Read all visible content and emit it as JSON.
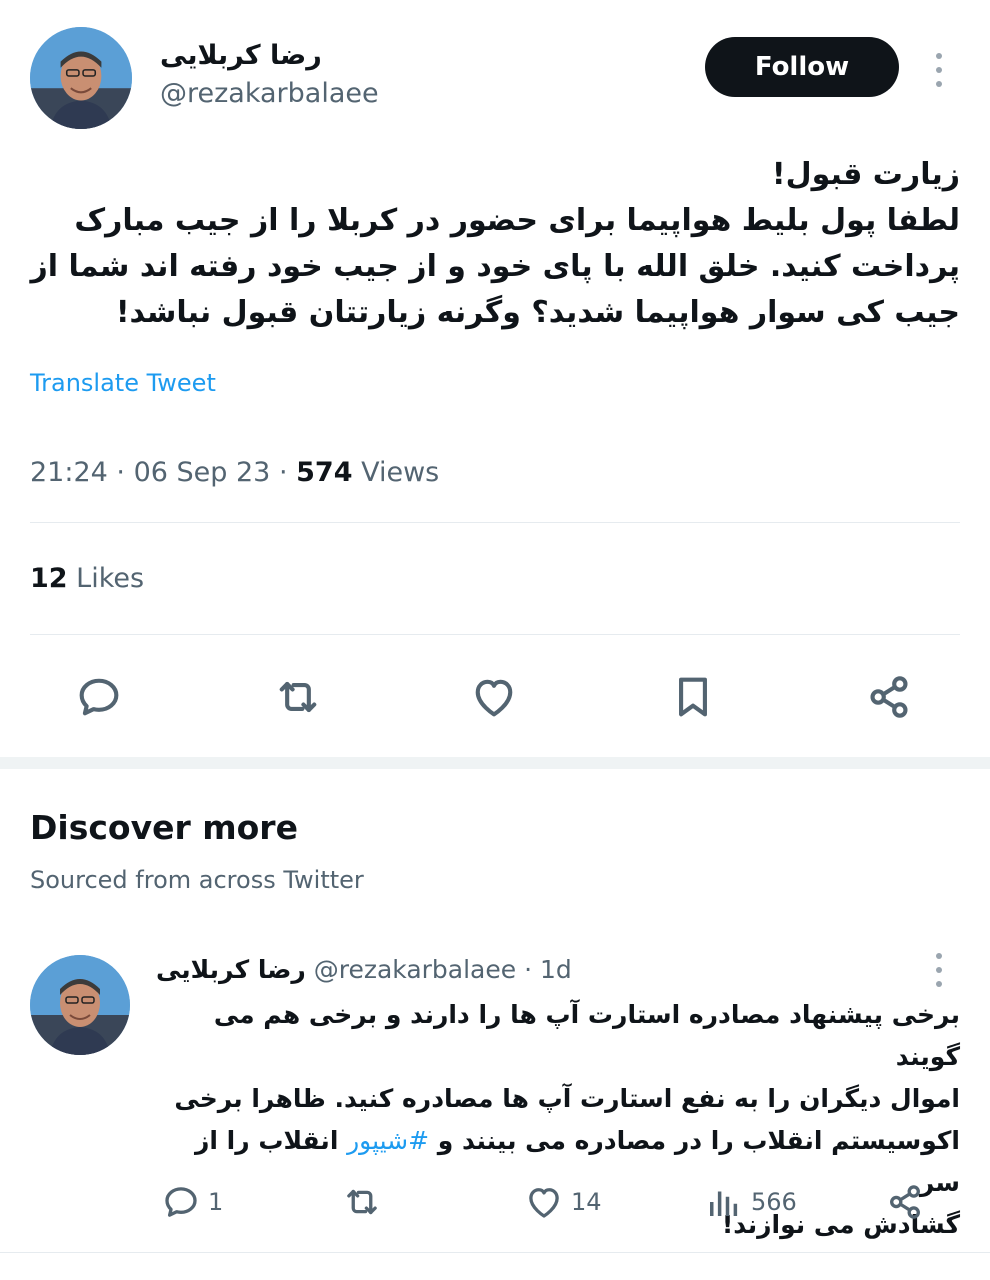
{
  "tweet": {
    "author_name": "رضا کربلایی",
    "author_handle": "@rezakarbalaee",
    "follow_label": "Follow",
    "text_lines": [
      "زیارت قبول!",
      "لطفا پول بلیط هواپیما برای حضور در کربلا را از جیب مبارک",
      "پرداخت کنید. خلق الله با پای خود و از جیب خود رفته اند شما از",
      "جیب کی سوار هواپیما شدید؟ وگرنه زیارتتان قبول نباشد!"
    ],
    "translate_label": "Translate Tweet",
    "time": "21:24",
    "date": "06 Sep 23",
    "views_count": "574",
    "views_label": "Views",
    "likes_count": "12",
    "likes_label": "Likes",
    "actions": [
      "reply-icon",
      "retweet-icon",
      "like-icon",
      "bookmark-icon",
      "share-icon"
    ]
  },
  "discover": {
    "title": "Discover more",
    "subtitle": "Sourced from across Twitter"
  },
  "related_tweet": {
    "author_name": "رضا کربلایی",
    "author_handle": "@rezakarbalaee",
    "age": "· 1d",
    "text_lines": [
      "برخی پیشنهاد مصادره استارت آپ ها را دارند و برخی هم می گویند",
      "اموال دیگران را به نفع استارت آپ ها مصادره کنید. ظاهرا برخی"
    ],
    "text_line3_before": "اکوسیستم انقلاب را در مصادره می بینند و ",
    "hashtag": "#شیپور",
    "text_line3_after": " انقلاب را از سر",
    "text_line4": "گشادش می نوازند!",
    "reply_count": "1",
    "like_count": "14",
    "views_count": "566"
  },
  "colors": {
    "accent": "#1d9bf0",
    "text": "#0f1419",
    "muted": "#536471",
    "follow_bg": "#0f1419"
  }
}
